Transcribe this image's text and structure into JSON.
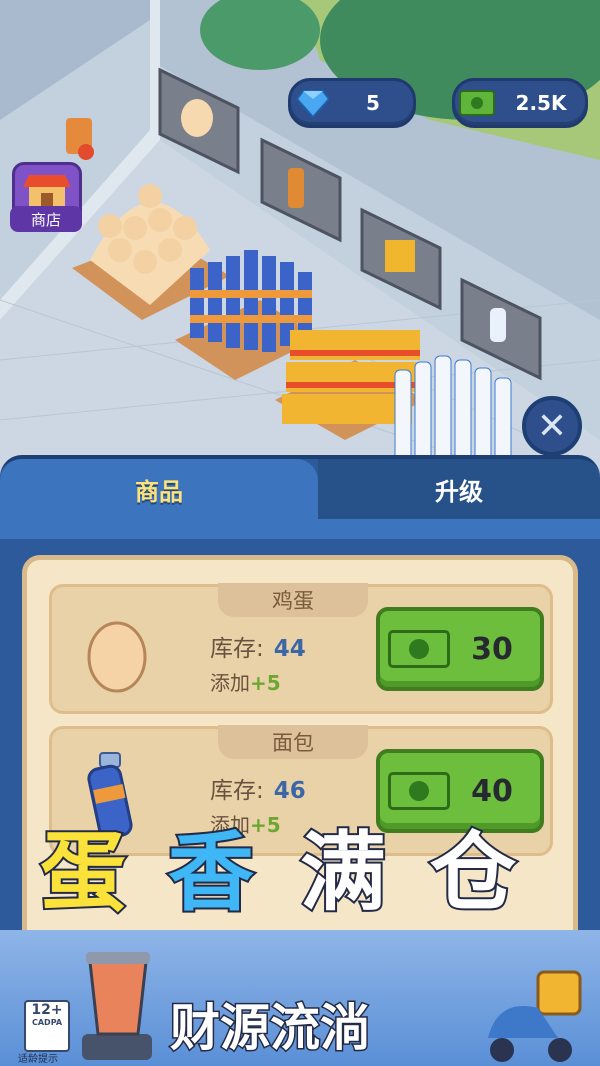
{
  "hud": {
    "gems": "5",
    "cash": "2.5K"
  },
  "shop_button": {
    "label": "商店"
  },
  "tabs": [
    {
      "label": "商品"
    },
    {
      "label": "升级"
    }
  ],
  "items": [
    {
      "name": "鸡蛋",
      "stock_label": "库存:",
      "stock": "44",
      "add_label": "添加",
      "add_value": "+5",
      "price": "30"
    },
    {
      "name": "面包",
      "stock_label": "库存:",
      "stock": "46",
      "add_label": "添加",
      "add_value": "+5",
      "price": "40"
    }
  ],
  "promo": {
    "title_parts": [
      "蛋",
      "香",
      "满",
      "仓"
    ],
    "subtitle": "财源流淌"
  },
  "age_rating": {
    "value": "12+",
    "org": "CADPA",
    "note": "适龄提示"
  },
  "colors": {
    "panel": "#2d5a9a",
    "tab_active_text": "#fbe27a",
    "buy_button": "#6cbe3c",
    "stock_number": "#3c67a7"
  },
  "icons": {
    "gem": "diamond-icon",
    "cash": "cash-icon",
    "close": "close-icon",
    "shop": "shop-icon",
    "egg": "egg-icon",
    "bottle": "bottle-icon"
  }
}
